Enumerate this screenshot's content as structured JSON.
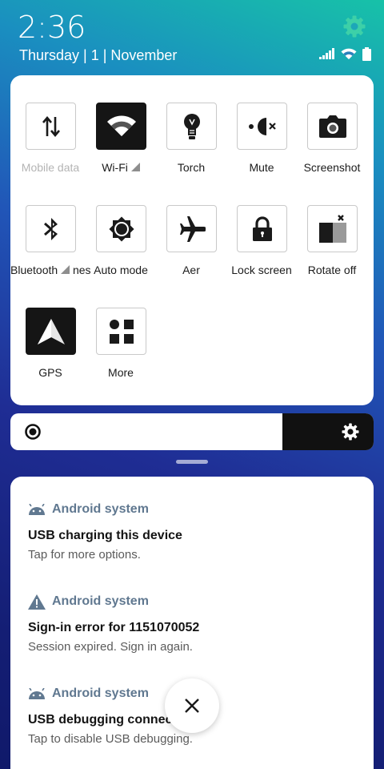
{
  "status": {
    "time": "2:36",
    "date": "Thursday | 1 | November",
    "icons": [
      "signal-icon",
      "wifi-icon",
      "battery-icon"
    ]
  },
  "header": {
    "settings_icon": "gear-icon"
  },
  "quick_settings": {
    "row1": [
      {
        "label": "Mobile data",
        "icon": "mobile-data-icon",
        "active": false,
        "disabled": true
      },
      {
        "label": "Wi-Fi",
        "icon": "wifi-icon",
        "active": true,
        "disabled": false
      },
      {
        "label": "Torch",
        "icon": "torch-icon",
        "active": false,
        "disabled": false
      },
      {
        "label": "Mute",
        "icon": "mute-icon",
        "active": false,
        "disabled": false
      },
      {
        "label": "Screenshot",
        "icon": "camera-icon",
        "active": false,
        "disabled": false
      }
    ],
    "row2": [
      {
        "label": "Bluetooth",
        "label_suffix": "ness",
        "icon": "bluetooth-icon",
        "active": false
      },
      {
        "label": "Auto",
        "label_suffix": "mode",
        "icon": "brightness-icon",
        "active": false
      },
      {
        "label": "Aer",
        "icon": "airplane-icon",
        "active": false
      },
      {
        "label": "Lock screen",
        "icon": "lock-icon",
        "active": false
      },
      {
        "label": "Rotate off",
        "icon": "rotate-icon",
        "active": false
      }
    ],
    "row3": [
      {
        "label": "GPS",
        "icon": "gps-icon",
        "active": true
      },
      {
        "label": "More",
        "icon": "grid-icon",
        "active": false
      }
    ]
  },
  "brightness": {
    "level": 0.75,
    "left_icon": "brightness-low-icon",
    "right_icon": "brightness-auto-icon"
  },
  "notifications": [
    {
      "app": "Android system",
      "app_icon": "android-icon",
      "title": "USB charging this device",
      "body": "Tap for more options."
    },
    {
      "app": "Android system",
      "app_icon": "warning-icon",
      "title": "Sign-in error for 1151070052",
      "body": "Session expired. Sign in again."
    },
    {
      "app": "Android system",
      "app_icon": "android-icon",
      "title": "USB debugging connect",
      "body": "Tap to disable USB debugging."
    }
  ],
  "close_button": {
    "icon": "close-icon"
  },
  "colors": {
    "accent_grey_blue": "#607890",
    "panel_bg": "#ffffff",
    "tile_active": "#151515"
  }
}
